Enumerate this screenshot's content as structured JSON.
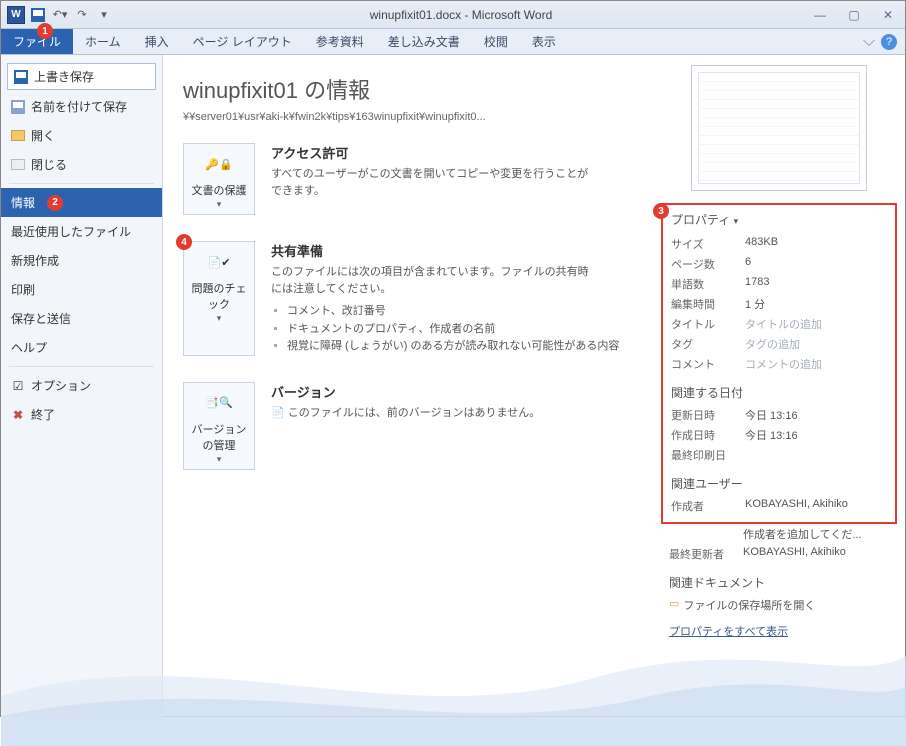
{
  "window": {
    "title": "winupfixit01.docx - Microsoft Word"
  },
  "ribbon": {
    "file": "ファイル",
    "home": "ホーム",
    "insert": "挿入",
    "pagelayout": "ページ レイアウト",
    "references": "参考資料",
    "mailings": "差し込み文書",
    "review": "校閲",
    "view": "表示"
  },
  "sidebar": {
    "save": "上書き保存",
    "saveas": "名前を付けて保存",
    "open": "開く",
    "close": "閉じる",
    "info": "情報",
    "recent": "最近使用したファイル",
    "new": "新規作成",
    "print": "印刷",
    "sendsave": "保存と送信",
    "help": "ヘルプ",
    "options": "オプション",
    "exit": "終了"
  },
  "doc": {
    "title": "winupfixit01 の情報",
    "path": "¥¥server01¥usr¥aki-k¥fwin2k¥tips¥163winupfixit¥winupfixit0..."
  },
  "permissions": {
    "heading": "アクセス許可",
    "desc": "すべてのユーザーがこの文書を開いてコピーや変更を行うことができます。",
    "btn": "文書の保護"
  },
  "prepare": {
    "heading": "共有準備",
    "desc": "このファイルには次の項目が含まれています。ファイルの共有時には注意してください。",
    "item1": "コメント、改訂番号",
    "item2": "ドキュメントのプロパティ、作成者の名前",
    "item3": "視覚に障碍 (しょうがい) のある方が読み取れない可能性がある内容",
    "btn": "問題のチェック"
  },
  "versions": {
    "heading": "バージョン",
    "desc": "このファイルには、前のバージョンはありません。",
    "btn": "バージョンの管理"
  },
  "props": {
    "heading": "プロパティ",
    "size_k": "サイズ",
    "size_v": "483KB",
    "pages_k": "ページ数",
    "pages_v": "6",
    "words_k": "単語数",
    "words_v": "1783",
    "edittime_k": "編集時間",
    "edittime_v": "1 分",
    "title_k": "タイトル",
    "title_v": "タイトルの追加",
    "tag_k": "タグ",
    "tag_v": "タグの追加",
    "comment_k": "コメント",
    "comment_v": "コメントの追加",
    "dates_heading": "関連する日付",
    "modified_k": "更新日時",
    "modified_v": "今日 13:16",
    "created_k": "作成日時",
    "created_v": "今日 13:16",
    "printed_k": "最終印刷日",
    "printed_v": "",
    "people_heading": "関連ユーザー",
    "author_k": "作成者",
    "author_v": "KOBAYASHI, Akihiko",
    "addauthor": "作成者を追加してくだ...",
    "lastmod_k": "最終更新者",
    "lastmod_v": "KOBAYASHI, Akihiko",
    "docs_heading": "関連ドキュメント",
    "openloc": "ファイルの保存場所を開く",
    "showall": "プロパティをすべて表示"
  },
  "badges": {
    "b1": "1",
    "b2": "2",
    "b3": "3",
    "b4": "4"
  }
}
